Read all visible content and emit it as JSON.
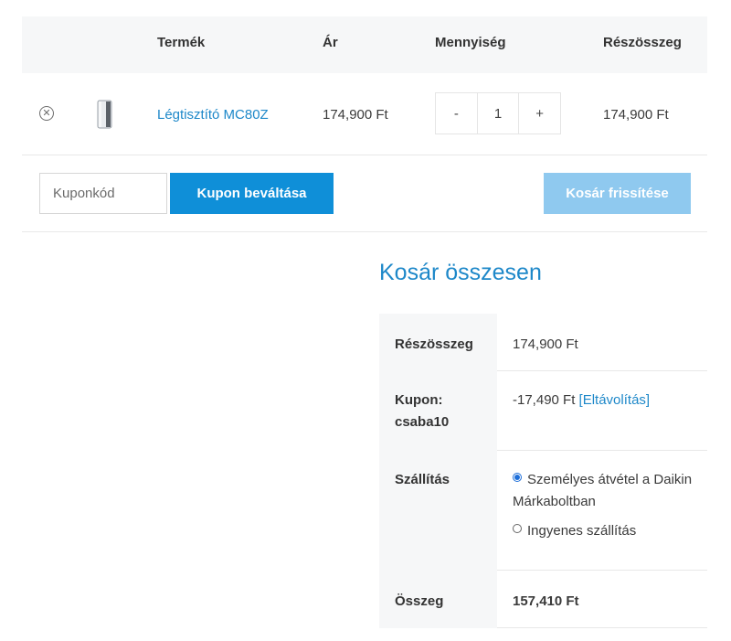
{
  "cart": {
    "headers": {
      "product": "Termék",
      "price": "Ár",
      "quantity": "Mennyiség",
      "subtotal": "Részösszeg"
    },
    "item": {
      "remove_icon": "close-circle-icon",
      "name": "Légtisztító MC80Z",
      "price": "174,900 Ft",
      "qty_minus": "-",
      "qty_value": "1",
      "qty_plus": "+",
      "subtotal": "174,900 Ft"
    },
    "coupon": {
      "placeholder": "Kuponkód",
      "apply_label": "Kupon beváltása"
    },
    "update_label": "Kosár frissítése"
  },
  "totals": {
    "title": "Kosár összesen",
    "subtotal_label": "Részösszeg",
    "subtotal_value": "174,900 Ft",
    "coupon_label": "Kupon: csaba10",
    "coupon_value": "-17,490 Ft",
    "coupon_remove": "[Eltávolítás]",
    "shipping_label": "Szállítás",
    "shipping_options": [
      {
        "label": "Személyes átvétel a Daikin Márkaboltban",
        "selected": true
      },
      {
        "label": "Ingyenes szállítás",
        "selected": false
      }
    ],
    "total_label": "Összeg",
    "total_value": "157,410 Ft"
  },
  "colors": {
    "accent": "#1e88c9",
    "apply_button": "#0f8fd8",
    "update_button_disabled": "#8fc9ef",
    "header_bg": "#f6f7f8"
  }
}
